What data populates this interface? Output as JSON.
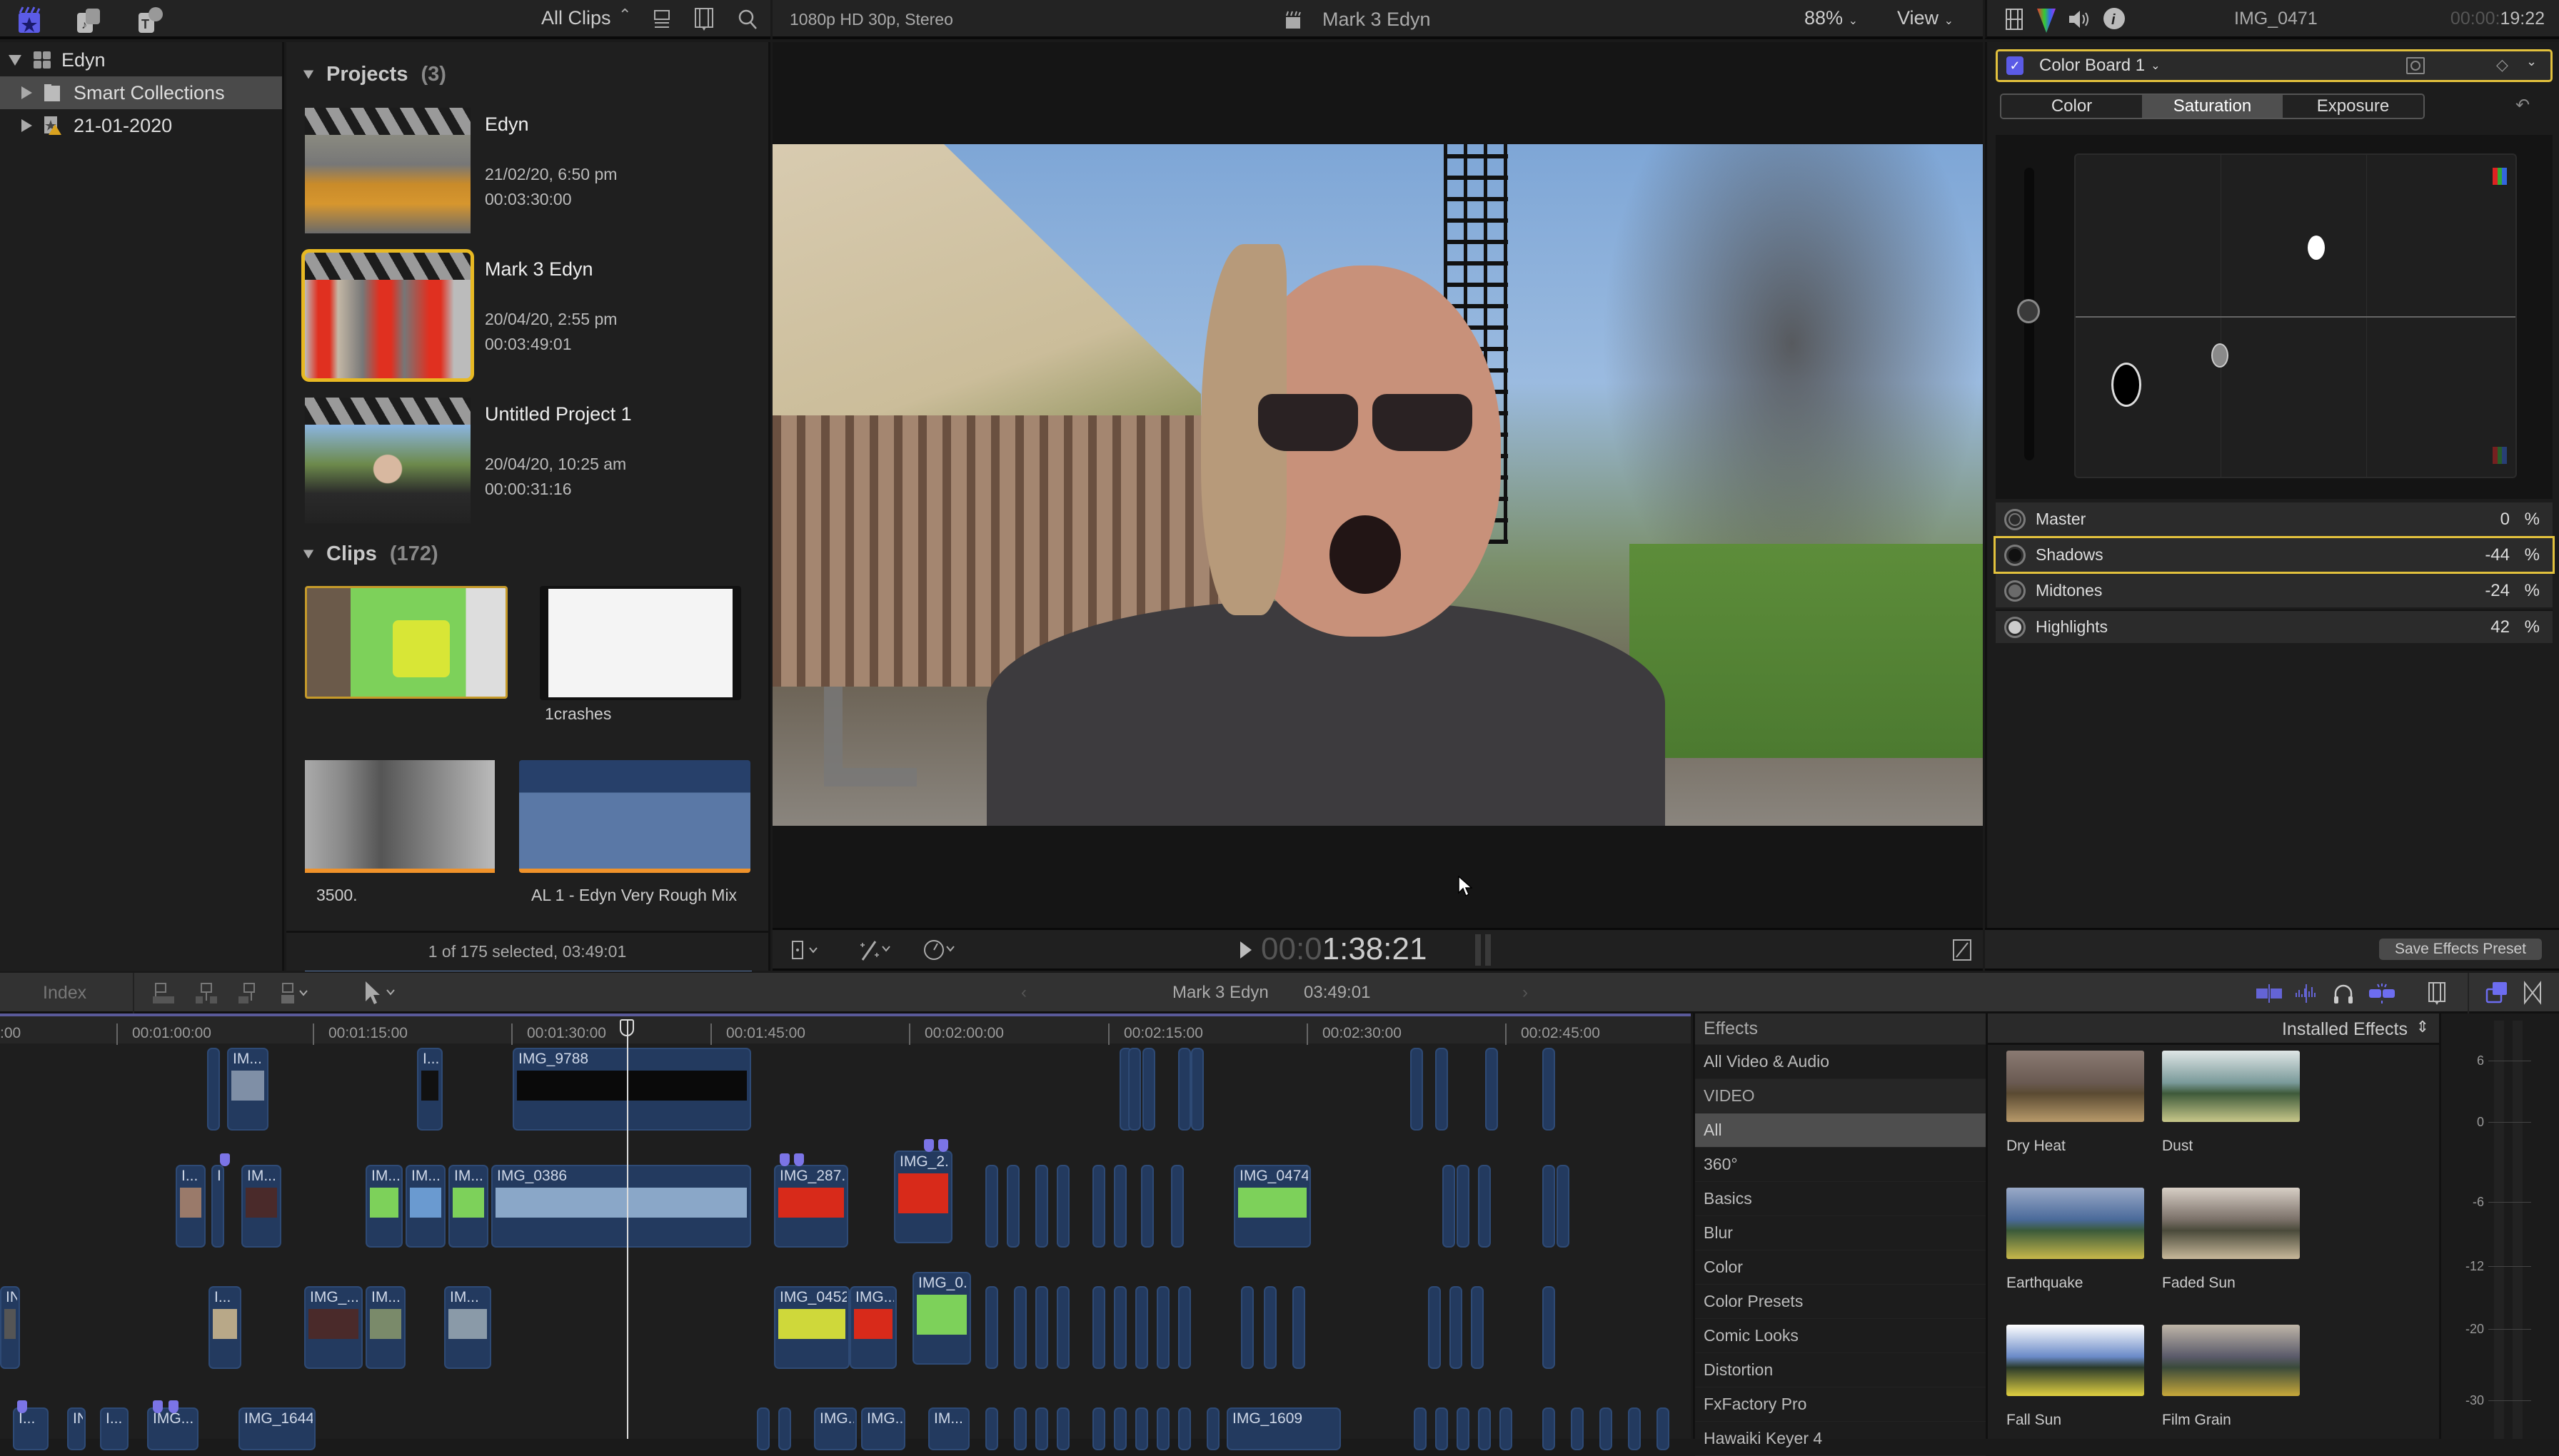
{
  "toolbar_left": {
    "icons": [
      "libraries-icon",
      "photos-audio-icon",
      "titles-generators-icon"
    ],
    "filter": "All Clips",
    "icons_right": [
      "list-view-icon",
      "clip-appearance-icon",
      "search-icon"
    ]
  },
  "viewer_header": {
    "format": "1080p HD 30p, Stereo",
    "project": "Mark 3 Edyn",
    "zoom": "88%",
    "view": "View"
  },
  "inspector_header": {
    "clip_name": "IMG_0471",
    "timecode_dim": "00:00:",
    "timecode": "19:22"
  },
  "libraries": [
    {
      "label": "Edyn",
      "expanded": true,
      "level": 0,
      "icon": "library-icon"
    },
    {
      "label": "Smart Collections",
      "expanded": false,
      "level": 1,
      "icon": "folder-icon",
      "selected": true
    },
    {
      "label": "21-01-2020",
      "expanded": false,
      "level": 1,
      "icon": "event-warning-icon"
    }
  ],
  "browser": {
    "projects_title": "Projects",
    "projects_count": "(3)",
    "projects": [
      {
        "name": "Edyn",
        "date": "21/02/20, 6:50 pm",
        "duration": "00:03:30:00"
      },
      {
        "name": "Mark 3 Edyn",
        "date": "20/04/20, 2:55 pm",
        "duration": "00:03:49:01",
        "selected": true
      },
      {
        "name": "Untitled Project 1",
        "date": "20/04/20, 10:25 am",
        "duration": "00:00:31:16"
      }
    ],
    "clips_title": "Clips",
    "clips_count": "(172)",
    "clips": [
      {
        "name": ""
      },
      {
        "name": "1crashes"
      },
      {
        "name": "3500."
      },
      {
        "name": "AL 1 - Edyn Very Rough Mix"
      }
    ],
    "status": "1 of 175 selected, 03:49:01"
  },
  "viewer_controls": {
    "timecode_dim": "00:0",
    "timecode": "1:38:21"
  },
  "inspector": {
    "effect_name": "Color Board 1",
    "effect_enabled": true,
    "tabs": [
      "Color",
      "Saturation",
      "Exposure"
    ],
    "active_tab": "Saturation",
    "params": [
      {
        "label": "Master",
        "value": "0",
        "unit": "%"
      },
      {
        "label": "Shadows",
        "value": "-44",
        "unit": "%",
        "selected": true
      },
      {
        "label": "Midtones",
        "value": "-24",
        "unit": "%"
      },
      {
        "label": "Highlights",
        "value": "42",
        "unit": "%"
      }
    ],
    "save_preset": "Save Effects Preset"
  },
  "timeline_toolbar": {
    "index": "Index",
    "project": "Mark 3 Edyn",
    "duration": "03:49:01"
  },
  "ruler": [
    "00:01:00:00",
    "00:01:15:00",
    "00:01:30:00",
    "00:01:45:00",
    "00:02:00:00",
    "00:02:15:00",
    "00:02:30:00",
    "00:02:45:00"
  ],
  "ruler_partial": ":00",
  "timeline_clips": [
    {
      "label": "IM..."
    },
    {
      "label": "I..."
    },
    {
      "label": "IMG_9788"
    },
    {
      "label": "I..."
    },
    {
      "label": "I"
    },
    {
      "label": "IM..."
    },
    {
      "label": "IM..."
    },
    {
      "label": "IM..."
    },
    {
      "label": "IM..."
    },
    {
      "label": "IMG_0386"
    },
    {
      "label": "IMG_287..."
    },
    {
      "label": "IMG_2..."
    },
    {
      "label": "IMG_0474"
    },
    {
      "label": "IN"
    },
    {
      "label": "I..."
    },
    {
      "label": "IMG_..."
    },
    {
      "label": "IM..."
    },
    {
      "label": "IM..."
    },
    {
      "label": "IMG_0452"
    },
    {
      "label": "IMG..."
    },
    {
      "label": "IMG_0..."
    },
    {
      "label": "I..."
    },
    {
      "label": "IN"
    },
    {
      "label": "I..."
    },
    {
      "label": "IMG..."
    },
    {
      "label": "IMG_1644"
    },
    {
      "label": "IMG..."
    },
    {
      "label": "IMG..."
    },
    {
      "label": "IM..."
    },
    {
      "label": "IMG_1609"
    }
  ],
  "effects": {
    "header": "Effects",
    "source": "Installed Effects",
    "categories": [
      "All Video & Audio",
      "VIDEO",
      "All",
      "360°",
      "Basics",
      "Blur",
      "Color",
      "Color Presets",
      "Comic Looks",
      "Distortion",
      "FxFactory Pro",
      "Hawaiki Keyer 4"
    ],
    "selected_category": "All",
    "items": [
      "Dry Heat",
      "Dust",
      "Earthquake",
      "Faded Sun",
      "Fall Sun",
      "Film Grain"
    ]
  },
  "meters": [
    "6",
    "0",
    "-6",
    "-12",
    "-20",
    "-30"
  ]
}
